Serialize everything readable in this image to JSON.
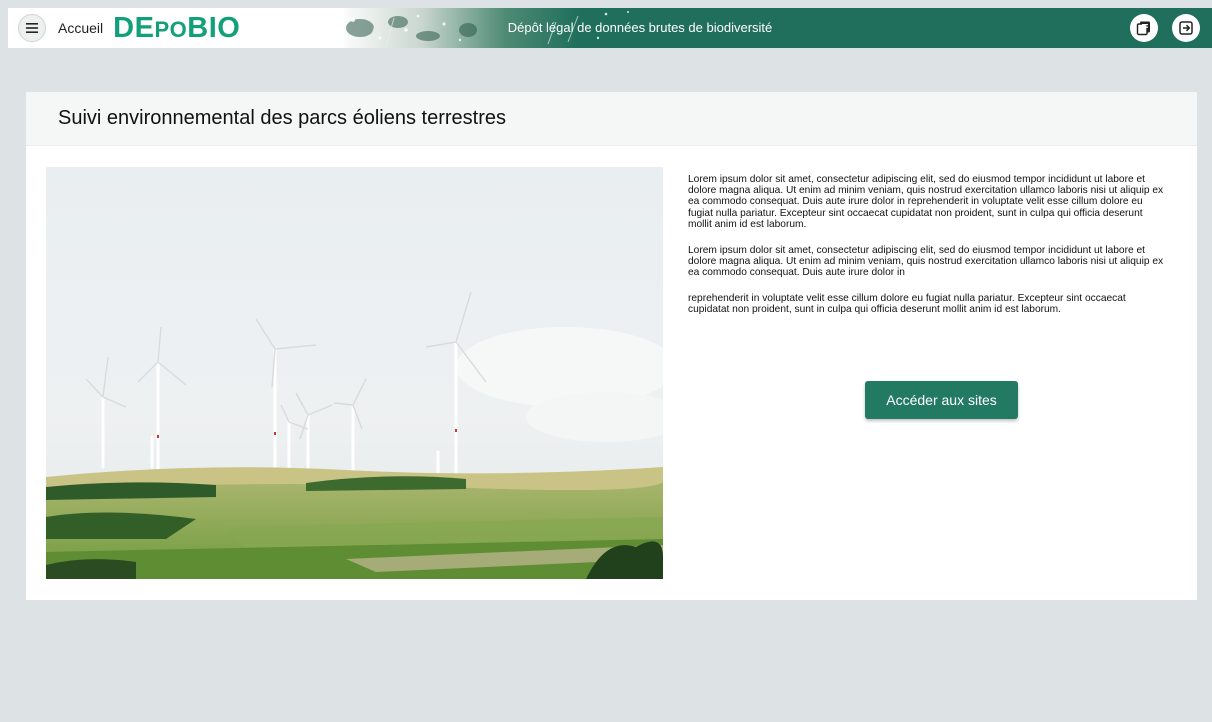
{
  "header": {
    "menu_icon": "hamburger-menu-icon",
    "home_label": "Accueil",
    "logo_text": "DEPOBIO",
    "logo_parts": [
      "D",
      "E",
      "P",
      "O",
      "BIO"
    ],
    "title": "Dépôt légal de données brutes de biodiversité",
    "right_icons": [
      "catalog-icon",
      "logout-icon"
    ],
    "colors": {
      "bar": "#1f6f5c",
      "logo": "#12a07a"
    }
  },
  "page": {
    "title": "Suivi environnemental des parcs éoliens terrestres",
    "image_icon": "wind-farm-photo",
    "paragraphs": [
      "Lorem ipsum dolor sit amet, consectetur adipiscing elit, sed do eiusmod tempor incididunt ut labore et dolore magna aliqua. Ut enim ad minim veniam, quis nostrud exercitation ullamco laboris nisi ut aliquip ex ea commodo consequat. Duis aute irure dolor in reprehenderit in voluptate velit esse cillum dolore eu fugiat nulla pariatur. Excepteur sint occaecat cupidatat non proident, sunt in culpa qui officia deserunt mollit anim id est laborum.",
      "Lorem ipsum dolor sit amet, consectetur adipiscing elit, sed do eiusmod tempor incididunt ut labore et dolore magna aliqua. Ut enim ad minim veniam, quis nostrud exercitation ullamco laboris nisi ut aliquip ex ea commodo consequat. Duis aute irure dolor in",
      "reprehenderit in voluptate velit esse cillum dolore eu fugiat nulla pariatur. Excepteur sint occaecat cupidatat non proident, sunt in culpa qui officia deserunt mollit anim id est laborum."
    ],
    "cta_label": "Accéder aux sites",
    "colors": {
      "button": "#237a63",
      "background": "#dde3e4"
    }
  }
}
